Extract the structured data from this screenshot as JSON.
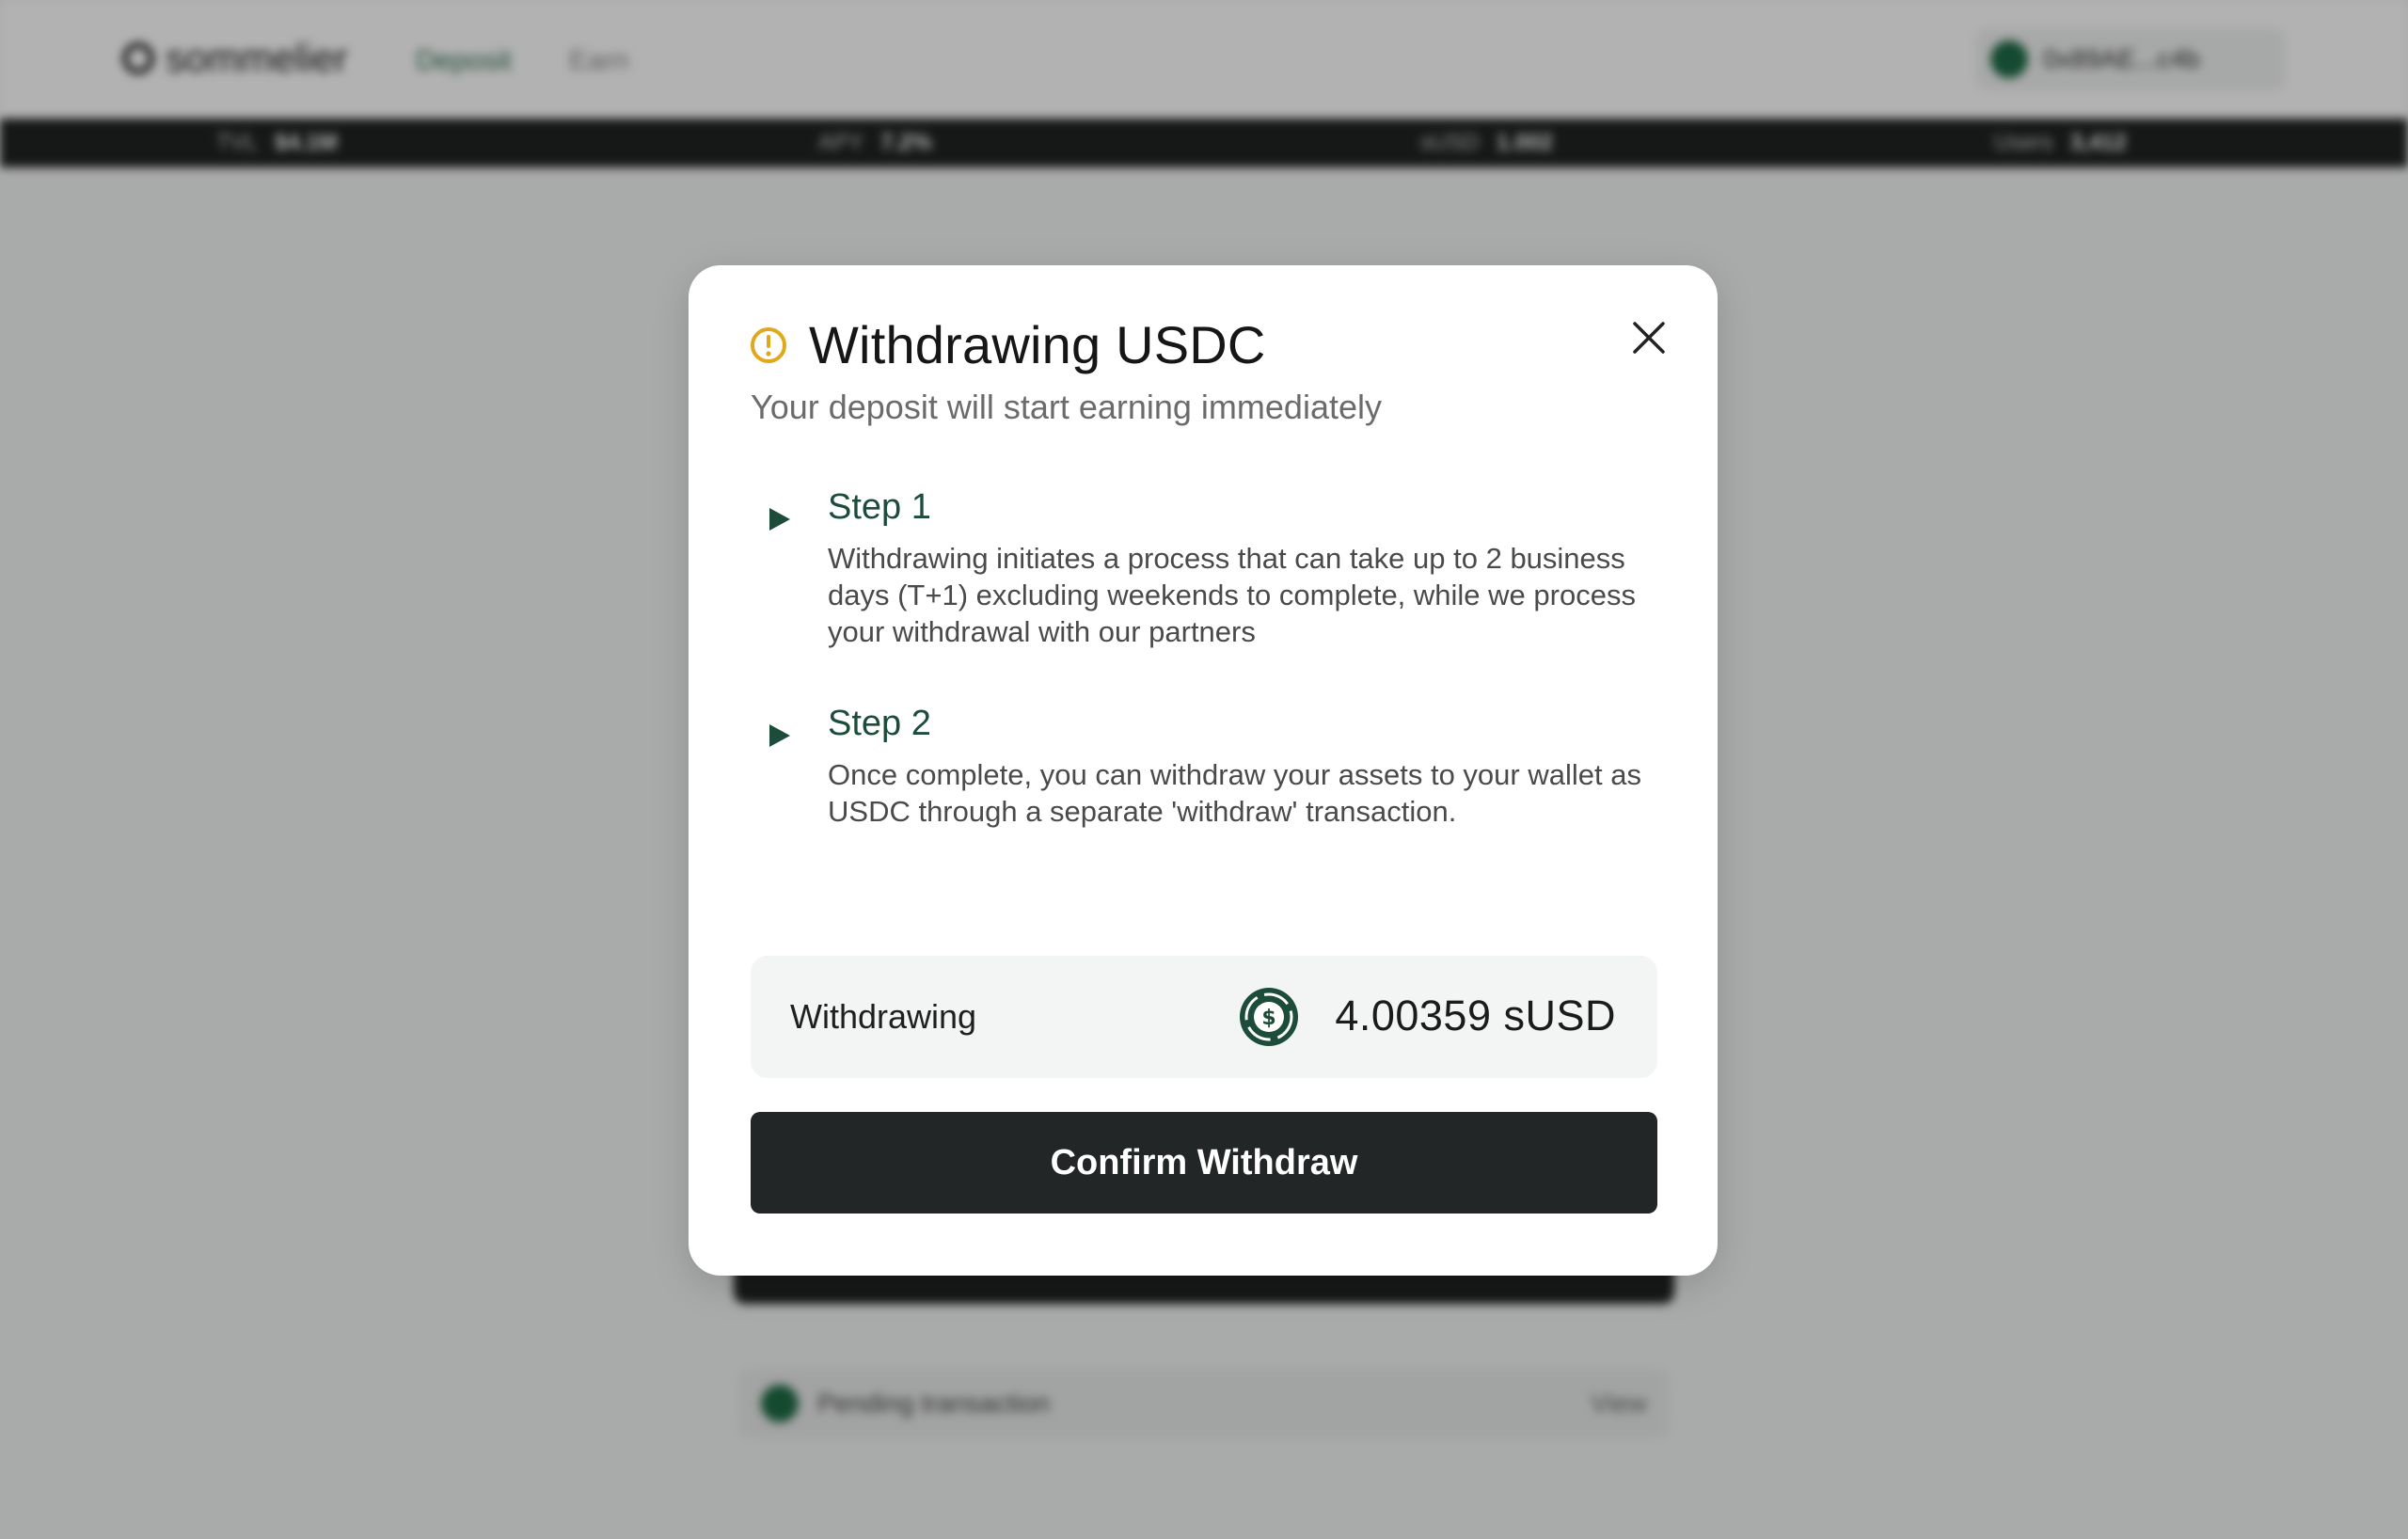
{
  "background": {
    "logo_text": "sommelier",
    "nav": [
      "Deposit",
      "Earn"
    ],
    "wallet_label": "0x89AE...c4b",
    "ticker": [
      {
        "name": "TVL",
        "value": "$4.1M"
      },
      {
        "name": "APY",
        "value": "7.2%"
      },
      {
        "name": "sUSD",
        "value": "1.002"
      },
      {
        "name": "Users",
        "value": "3,412"
      }
    ],
    "pending_label": "Pending transaction",
    "pending_view": "View"
  },
  "modal": {
    "title": "Withdrawing USDC",
    "subtitle": "Your deposit will start earning immediately",
    "steps": [
      {
        "title": "Step 1",
        "body": "Withdrawing initiates a process that can take up to 2 business days (T+1) excluding weekends to complete, while we process your withdrawal with our partners"
      },
      {
        "title": "Step 2",
        "body": "Once complete, you can withdraw your assets to your wallet as USDC through a separate 'withdraw' transaction."
      }
    ],
    "withdraw_label": "Withdrawing",
    "withdraw_amount": "4.00359 sUSD",
    "confirm_label": "Confirm Withdraw"
  },
  "icons": {
    "warning": "warning-circle-icon",
    "close": "close-icon",
    "step_arrow": "play-triangle-icon",
    "coin": "dollar-coin-icon"
  },
  "colors": {
    "accent_green": "#1d4d3a",
    "warning_yellow": "#e0a81c",
    "button_dark": "#232626"
  }
}
